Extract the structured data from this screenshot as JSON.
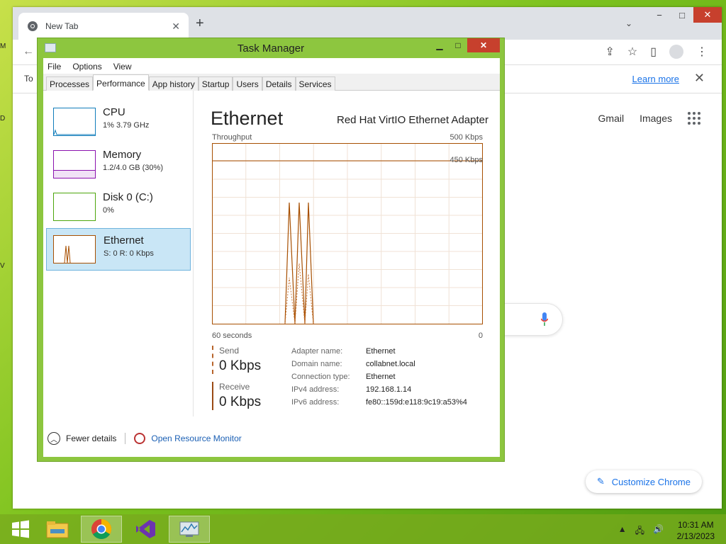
{
  "chrome": {
    "tab_title": "New Tab",
    "infobar_text": "To",
    "learn_more": "Learn more",
    "ntp_links": [
      "Gmail",
      "Images"
    ],
    "customize_label": "Customize Chrome"
  },
  "task_manager": {
    "title": "Task Manager",
    "menu": [
      "File",
      "Options",
      "View"
    ],
    "tabs": [
      "Processes",
      "Performance",
      "App history",
      "Startup",
      "Users",
      "Details",
      "Services"
    ],
    "active_tab": "Performance",
    "resources": [
      {
        "name": "CPU",
        "value": "1% 3.79 GHz",
        "color": "#117dbb"
      },
      {
        "name": "Memory",
        "value": "1.2/4.0 GB (30%)",
        "color": "#8b12ae"
      },
      {
        "name": "Disk 0 (C:)",
        "value": "0%",
        "color": "#4da60c"
      },
      {
        "name": "Ethernet",
        "value": "S: 0 R: 0 Kbps",
        "color": "#a74f01"
      }
    ],
    "selected_resource": "Ethernet",
    "detail": {
      "title": "Ethernet",
      "adapter": "Red Hat VirtIO Ethernet Adapter",
      "throughput_label": "Throughput",
      "max_label": "500 Kbps",
      "scale_label": "450 Kbps",
      "time_label": "60 seconds",
      "zero_label": "0",
      "send_label": "Send",
      "send_value": "0 Kbps",
      "receive_label": "Receive",
      "receive_value": "0 Kbps",
      "info": [
        {
          "key": "Adapter name:",
          "value": "Ethernet"
        },
        {
          "key": "Domain name:",
          "value": "collabnet.local"
        },
        {
          "key": "Connection type:",
          "value": "Ethernet"
        },
        {
          "key": "IPv4 address:",
          "value": "192.168.1.14"
        },
        {
          "key": "IPv6 address:",
          "value": "fe80::159d:e118:9c19:a53%4"
        }
      ]
    },
    "footer": {
      "fewer_details": "Fewer details",
      "open_resource_monitor": "Open Resource Monitor"
    }
  },
  "taskbar": {
    "time": "10:31 AM",
    "date": "2/13/2023",
    "apps": [
      "start-icon",
      "file-explorer-icon",
      "chrome-icon",
      "visual-studio-icon",
      "task-manager-icon"
    ]
  },
  "colors": {
    "ethernet": "#a74f01",
    "chrome_link": "#1a73e8",
    "window_frame": "#8dc63f"
  }
}
